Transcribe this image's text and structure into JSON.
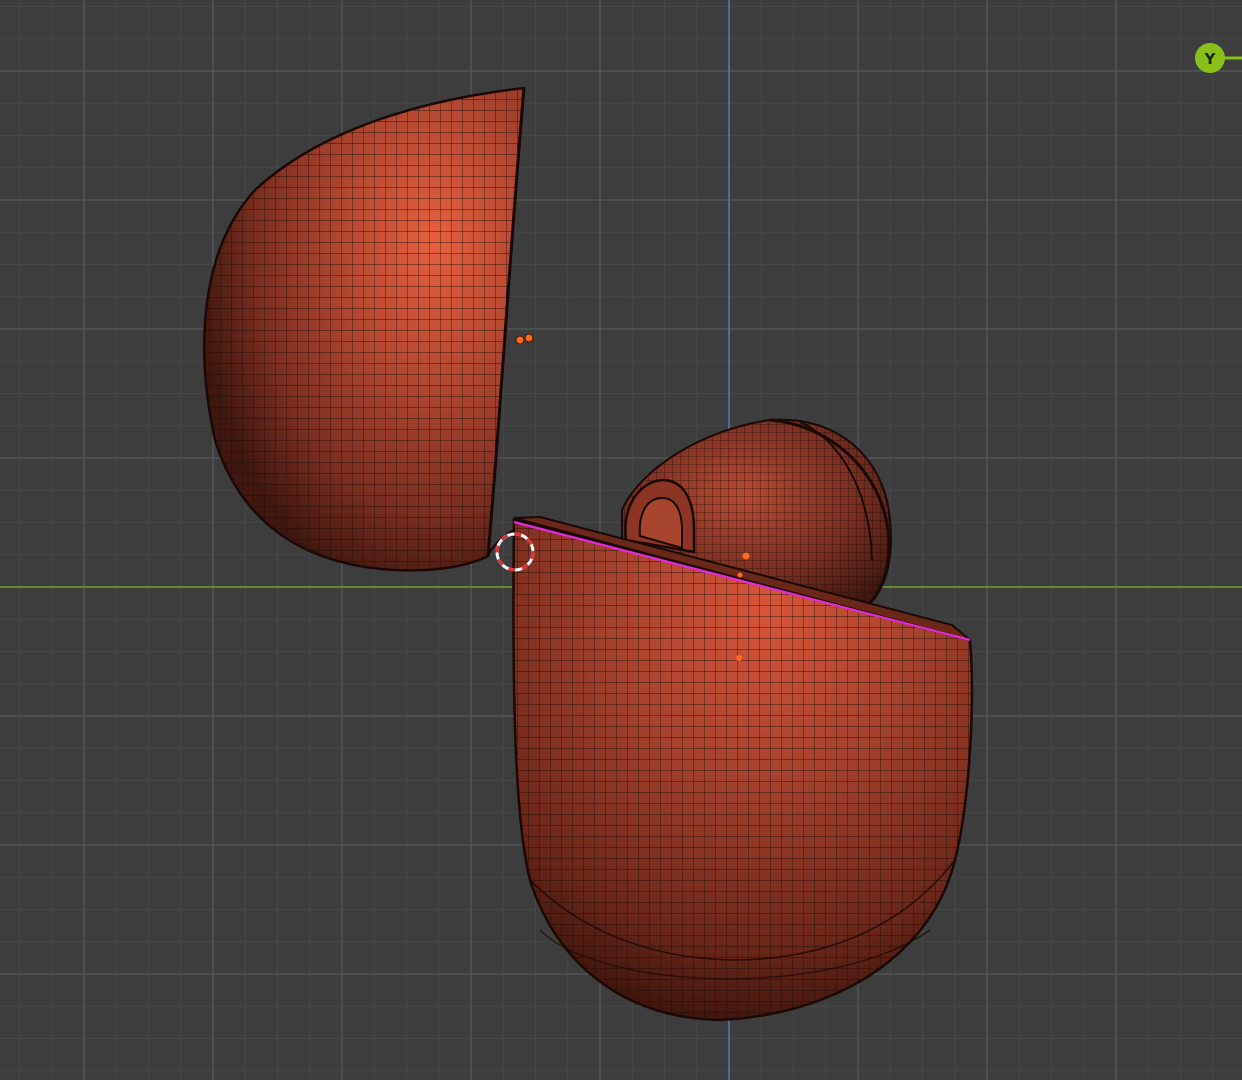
{
  "viewport": {
    "type": "3d-viewport",
    "projection": "orthographic",
    "shading": "solid-wireframe"
  },
  "colors": {
    "background": "#3d3d3d",
    "grid_minor": "#474747",
    "grid_major": "#535353",
    "axis_x": "#6e9a2c",
    "axis_y": "#4f73b8",
    "mesh_light": "#d9553c",
    "mesh_mid": "#a8452f",
    "mesh_dark": "#4a1c14",
    "wire": "#1c0b07",
    "selected_edge": "#e22bd8",
    "origin_dot": "#ff6a1a",
    "cursor_red": "#d8343a",
    "cursor_white": "#ffffff",
    "gizmo": "#88c019"
  },
  "gizmo": {
    "axis_label": "Y"
  },
  "icons": {
    "cursor": "3d-cursor-icon",
    "gizmo": "navigation-gizmo-icon",
    "origin": "object-origin-icon"
  },
  "objects": [
    {
      "name": "case-lid"
    },
    {
      "name": "case-base"
    },
    {
      "name": "earbud"
    }
  ]
}
